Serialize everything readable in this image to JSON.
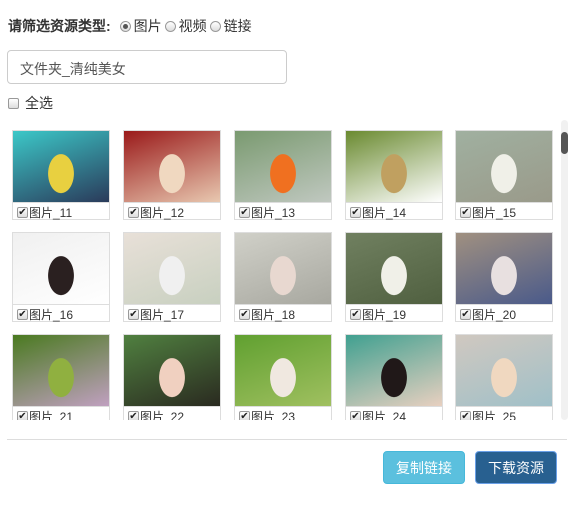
{
  "filter": {
    "label": "请筛选资源类型:",
    "options": [
      {
        "label": "图片",
        "selected": true
      },
      {
        "label": "视频",
        "selected": false
      },
      {
        "label": "链接",
        "selected": false
      }
    ]
  },
  "folder": "文件夹_清纯美女",
  "select_all": "全选",
  "items": [
    {
      "label": "图片_11",
      "checked": true,
      "colors": [
        "#3cc8c8",
        "#e8d040",
        "#2a3a5a"
      ]
    },
    {
      "label": "图片_12",
      "checked": true,
      "colors": [
        "#9a1a1a",
        "#f0d8c0",
        "#e8c8b0"
      ]
    },
    {
      "label": "图片_13",
      "checked": true,
      "colors": [
        "#7a9a70",
        "#f07020",
        "#c0c8c0"
      ]
    },
    {
      "label": "图片_14",
      "checked": true,
      "colors": [
        "#6a8a30",
        "#c0a060",
        "#fff"
      ]
    },
    {
      "label": "图片_15",
      "checked": true,
      "colors": [
        "#a0b0a0",
        "#f0f0e8",
        "#9a9a8a"
      ]
    },
    {
      "label": "图片_16",
      "checked": true,
      "colors": [
        "#f0f0f0",
        "#2a2020",
        "#fff"
      ]
    },
    {
      "label": "图片_17",
      "checked": true,
      "colors": [
        "#e8e0d8",
        "#f0f0f0",
        "#c8d0c0"
      ]
    },
    {
      "label": "图片_18",
      "checked": true,
      "colors": [
        "#d0d0c8",
        "#e8d8d0",
        "#a8a8a0"
      ]
    },
    {
      "label": "图片_19",
      "checked": true,
      "colors": [
        "#708060",
        "#f0f0e8",
        "#506040"
      ]
    },
    {
      "label": "图片_20",
      "checked": true,
      "colors": [
        "#a09080",
        "#e8e0e0",
        "#4a5a8a"
      ]
    },
    {
      "label": "图片_21",
      "checked": true,
      "colors": [
        "#4a7a20",
        "#90b040",
        "#c0a0c0"
      ]
    },
    {
      "label": "图片_22",
      "checked": true,
      "colors": [
        "#508040",
        "#f0d0c0",
        "#2a2a20"
      ]
    },
    {
      "label": "图片_23",
      "checked": true,
      "colors": [
        "#60a030",
        "#f0e8e0",
        "#a0c060"
      ]
    },
    {
      "label": "图片_24",
      "checked": true,
      "colors": [
        "#40a090",
        "#201818",
        "#e8d0c0"
      ]
    },
    {
      "label": "图片_25",
      "checked": true,
      "colors": [
        "#d0c8c0",
        "#f0d8c0",
        "#a0c0c8"
      ]
    }
  ],
  "buttons": {
    "copy": "复制链接",
    "download": "下载资源"
  }
}
